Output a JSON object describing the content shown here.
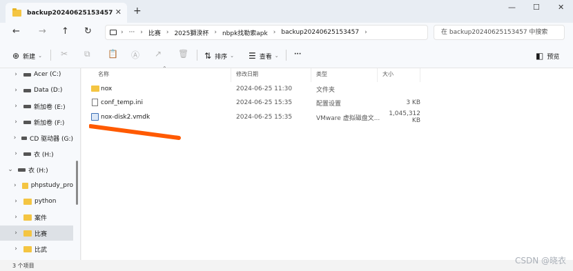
{
  "tab": {
    "title": "backup20240625153457",
    "close": "✕",
    "new": "+"
  },
  "window": {
    "minimize": "—",
    "maximize": "☐",
    "close": "✕"
  },
  "nav_buttons": {
    "back": "←",
    "forward": "→",
    "up": "↑",
    "refresh": "↻"
  },
  "address": {
    "more": "···",
    "sep": "›",
    "segments": [
      "比赛",
      "2025獅湀杯",
      "nbpk找勒索apk",
      "backup20240625153457"
    ]
  },
  "search": {
    "placeholder": "在 backup20240625153457 中搜索"
  },
  "toolbar": {
    "new_label": "新建",
    "sort_label": "排序",
    "view_label": "查看",
    "more": "···",
    "preview_label": "预览",
    "icons": [
      "cut-icon",
      "copy-icon",
      "paste-icon",
      "rename-icon",
      "share-icon",
      "delete-icon"
    ]
  },
  "nav_items": [
    {
      "label": "Acer (C:)",
      "icon": "drive-icon",
      "expanded": false
    },
    {
      "label": "Data (D:)",
      "icon": "drive-icon",
      "expanded": false
    },
    {
      "label": "新加卷 (E:)",
      "icon": "drive-icon",
      "expanded": false
    },
    {
      "label": "新加卷 (F:)",
      "icon": "drive-icon",
      "expanded": false
    },
    {
      "label": "CD 驱动器 (G:)",
      "icon": "drive-icon",
      "expanded": false
    },
    {
      "label": "衣 (H:)",
      "icon": "drive-icon",
      "expanded": false
    },
    {
      "label": "衣 (H:)",
      "icon": "drive-icon",
      "expanded": true
    },
    {
      "label": "phpstudy_pro",
      "icon": "folder-icon",
      "expanded": false
    },
    {
      "label": "python",
      "icon": "folder-icon",
      "expanded": false
    },
    {
      "label": "案件",
      "icon": "folder-icon",
      "expanded": false
    },
    {
      "label": "比赛",
      "icon": "folder-icon",
      "expanded": false,
      "selected": true
    },
    {
      "label": "比武",
      "icon": "folder-icon",
      "expanded": false
    }
  ],
  "columns": {
    "name": "名称",
    "date": "修改日期",
    "type": "类型",
    "size": "大小"
  },
  "files": [
    {
      "name": "nox",
      "date": "2024-06-25 11:30",
      "type": "文件夹",
      "size": "",
      "icon": "folder-icon"
    },
    {
      "name": "conf_temp.ini",
      "date": "2024-06-25 15:35",
      "type": "配置设置",
      "size": "3 KB",
      "icon": "ini-file-icon"
    },
    {
      "name": "nox-disk2.vmdk",
      "date": "2024-06-25 15:35",
      "type": "VMware 虚拟磁盘文...",
      "size": "1,045,312 KB",
      "icon": "vmdk-file-icon"
    }
  ],
  "status": {
    "count": "3 个项目"
  },
  "watermark": "CSDN @晓衣"
}
